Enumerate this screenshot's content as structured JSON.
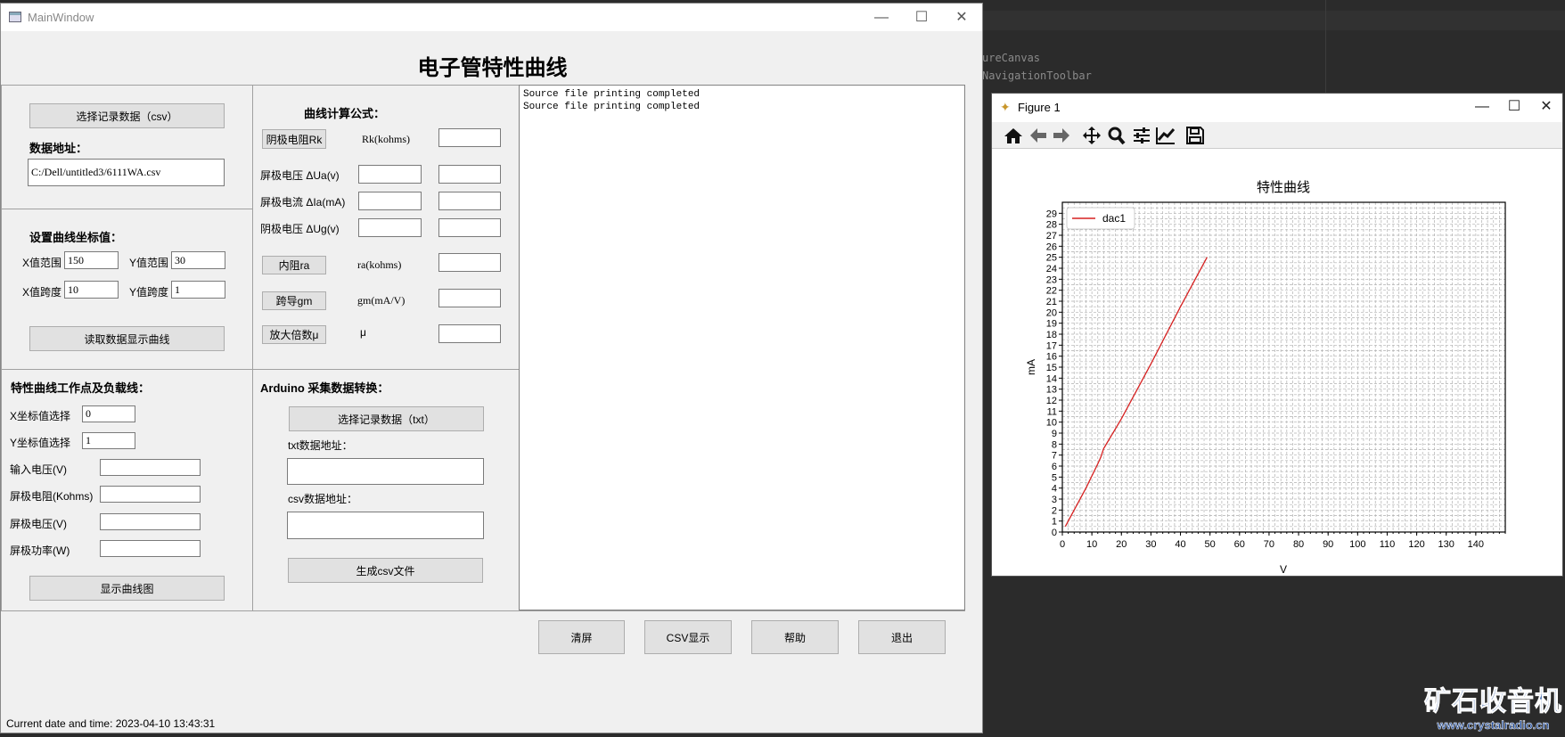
{
  "background": {
    "code_lines": [
      "ureCanvas",
      "NavigationToolbar"
    ]
  },
  "main_window": {
    "title": "MainWindow",
    "heading": "电子管特性曲线"
  },
  "file_section": {
    "select_csv_button": "选择记录数据（csv）",
    "data_address_label": "数据地址：",
    "data_address_value": "C:/Dell/untitled3/6111WA.csv"
  },
  "axis_section": {
    "title": "设置曲线坐标值：",
    "x_range_label": "X值范围",
    "x_range_value": "150",
    "y_range_label": "Y值范围",
    "y_range_value": "30",
    "x_step_label": "X值跨度",
    "x_step_value": "10",
    "y_step_label": "Y值跨度",
    "y_step_value": "1",
    "read_button": "读取数据显示曲线"
  },
  "formula_section": {
    "title": "曲线计算公式：",
    "rk_button": "阴极电阻Rk",
    "rk_label": "Rk(kohms)",
    "ua_label": "屏极电压 ΔUa(v)",
    "ia_label": "屏极电流 ΔIa(mA)",
    "ug_label": "阴极电压 ΔUg(v)",
    "ra_button": "内阻ra",
    "ra_label": "ra(kohms)",
    "gm_button": "跨导gm",
    "gm_label": "gm(mA/V)",
    "mu_button": "放大倍数μ",
    "mu_label": "μ"
  },
  "workpoint_section": {
    "title": "特性曲线工作点及负载线：",
    "x_select_label": "X坐标值选择",
    "x_select_value": "0",
    "y_select_label": "Y坐标值选择",
    "y_select_value": "1",
    "input_voltage_label": "输入电压(V)",
    "plate_resistance_label": "屏极电阻(Kohms)",
    "plate_voltage_label": "屏极电压(V)",
    "plate_power_label": "屏极功率(W)",
    "show_button": "显示曲线图"
  },
  "arduino_section": {
    "title": "Arduino 采集数据转换：",
    "select_txt_button": "选择记录数据（txt）",
    "txt_address_label": "txt数据地址：",
    "csv_address_label": "csv数据地址：",
    "generate_button": "生成csv文件"
  },
  "log": {
    "lines": [
      "Source file printing completed",
      "Source file printing completed"
    ]
  },
  "bottom_buttons": {
    "clear": "清屏",
    "csv": "CSV显示",
    "help": "帮助",
    "exit": "退出"
  },
  "status": {
    "datetime_label": "Current date and time:",
    "datetime": "2023-04-10 13:43:31"
  },
  "figure": {
    "title": "Figure 1",
    "toolbar": [
      "home-icon",
      "back-icon",
      "forward-icon",
      "pan-icon",
      "zoom-icon",
      "subplots-icon",
      "edit-axis-icon",
      "save-icon"
    ]
  },
  "chart_data": {
    "type": "line",
    "title": "特性曲线",
    "xlabel": "V",
    "ylabel": "mA",
    "xlim": [
      0,
      150
    ],
    "ylim": [
      0,
      30
    ],
    "xticks": [
      0,
      10,
      20,
      30,
      40,
      50,
      60,
      70,
      80,
      90,
      100,
      110,
      120,
      130,
      140
    ],
    "yticks": [
      0,
      1,
      2,
      3,
      4,
      5,
      6,
      7,
      8,
      9,
      10,
      11,
      12,
      13,
      14,
      15,
      16,
      17,
      18,
      19,
      20,
      21,
      22,
      23,
      24,
      25,
      26,
      27,
      28,
      29
    ],
    "grid": true,
    "legend_position": "top-left",
    "series": [
      {
        "name": "dac1",
        "color": "#d62020",
        "x": [
          1,
          4,
          8,
          12,
          13,
          14,
          20,
          30,
          40,
          45,
          49
        ],
        "y": [
          0.5,
          2,
          4,
          6.2,
          6.8,
          7.6,
          10.3,
          15.3,
          20.5,
          23,
          25
        ]
      }
    ]
  },
  "watermark": {
    "name": "矿石收音机",
    "url": "www.crystalradio.cn"
  }
}
